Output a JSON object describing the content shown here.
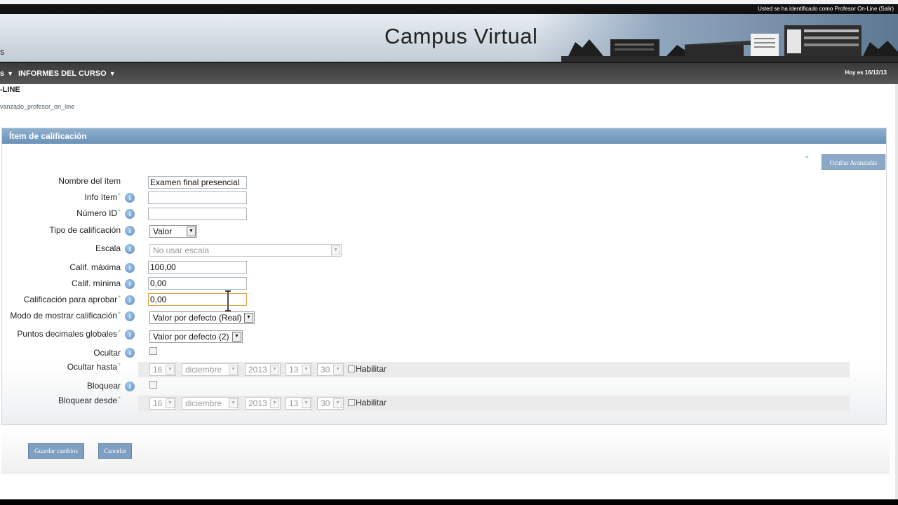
{
  "header": {
    "login_info": "Usted se ha identificado como Profesor On-Line (Salir)",
    "left_fragment": "s",
    "site_title": "Campus Virtual"
  },
  "nav": {
    "left_fragment": "s",
    "item_label": "INFORMES DEL CURSO",
    "date": "Hoy es 16/12/13"
  },
  "course": {
    "name_fragment": "-LINE",
    "breadcrumb_fragment": "vanzado_profesor_on_line"
  },
  "panel": {
    "title": "Ítem de calificación",
    "advanced_button": "Ocultar Avanzadas"
  },
  "form": {
    "item_name": {
      "label": "Nombre del ítem",
      "value": "Examen final presencial"
    },
    "item_info": {
      "label": "Info ítem",
      "value": ""
    },
    "id_number": {
      "label": "Número ID",
      "value": ""
    },
    "grade_type": {
      "label": "Tipo de calificación",
      "value": "Valor"
    },
    "scale": {
      "label": "Escala",
      "value": "No usar escala"
    },
    "grade_max": {
      "label": "Calif. máxima",
      "value": "100,00"
    },
    "grade_min": {
      "label": "Calif. mínima",
      "value": "0,00"
    },
    "grade_pass": {
      "label": "Calificación para aprobar",
      "value": "0,00"
    },
    "display_mode": {
      "label": "Modo de mostrar calificación",
      "value": "Valor por defecto (Real)"
    },
    "decimal_points": {
      "label": "Puntos decimales globales",
      "value": "Valor por defecto (2)"
    },
    "hidden": {
      "label": "Ocultar"
    },
    "hidden_until": {
      "label": "Ocultar hasta",
      "day": "16",
      "month": "diciembre",
      "year": "2013",
      "hour": "13",
      "minute": "30",
      "enable_label": "Habilitar"
    },
    "locked": {
      "label": "Bloquear"
    },
    "locked_after": {
      "label": "Bloquear desde",
      "day": "16",
      "month": "diciembre",
      "year": "2013",
      "hour": "13",
      "minute": "30",
      "enable_label": "Habilitar"
    },
    "help_glyph": "i",
    "required_mark": "*"
  },
  "footer": {
    "save_button": "Guardar cambios",
    "cancel_button": "Cancelar"
  },
  "colors": {
    "panel_header": "#7aa0c4",
    "button": "#7f9fc0",
    "nav": "#4a4a4a"
  }
}
